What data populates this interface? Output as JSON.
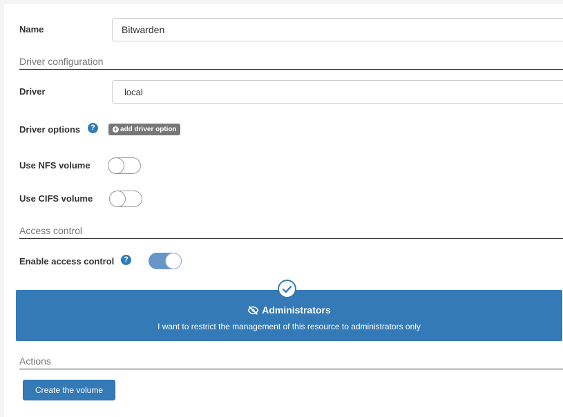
{
  "form": {
    "name": {
      "label": "Name",
      "value": "Bitwarden"
    },
    "driver_configuration": {
      "title": "Driver configuration",
      "driver_label": "Driver",
      "driver_value": "local",
      "driver_options_label": "Driver options",
      "add_driver_option_label": "add driver option",
      "use_nfs_label": "Use NFS volume",
      "use_nfs_enabled": false,
      "use_cifs_label": "Use CIFS volume",
      "use_cifs_enabled": false
    },
    "access_control": {
      "title": "Access control",
      "enable_label": "Enable access control",
      "enabled": true,
      "option": {
        "title": "Administrators",
        "description": "I want to restrict the management of this resource to administrators only",
        "selected": true
      }
    },
    "actions": {
      "title": "Actions",
      "create_label": "Create the volume"
    }
  },
  "icons": {
    "help": "question-circle-icon",
    "plus": "plus-circle-icon",
    "eye_slash": "eye-slash-icon",
    "check": "check-circle-icon"
  },
  "colors": {
    "primary": "#337ab7",
    "badge": "#777777",
    "toggle_on": "#6896c9"
  }
}
